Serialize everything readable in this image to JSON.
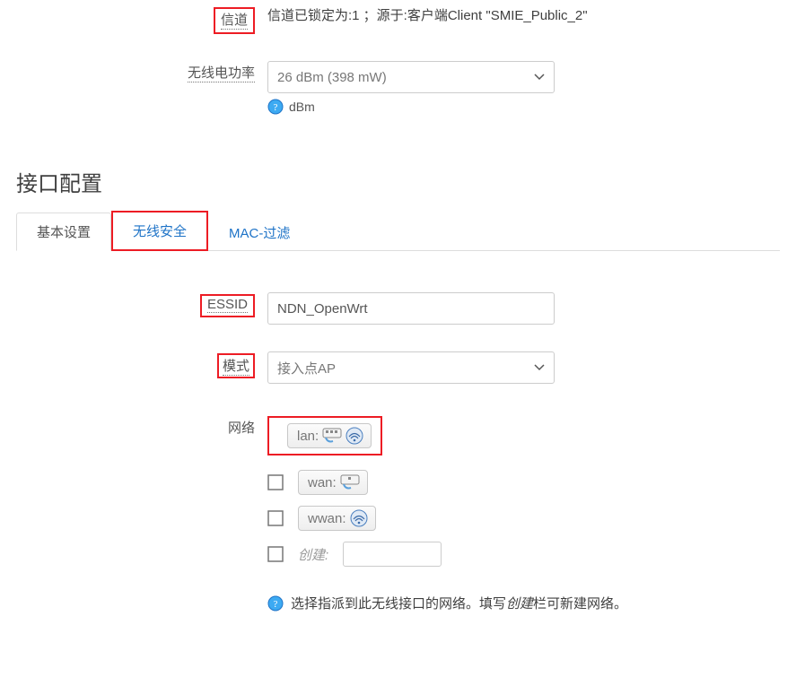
{
  "device": {
    "channel_label": "信道",
    "channel_status": "信道已锁定为:1 ；源于:客户端Client \"SMIE_Public_2\"",
    "txpower_label": "无线电功率",
    "txpower_value": "26 dBm (398 mW)",
    "txpower_unit": "dBm"
  },
  "section_title": "接口配置",
  "tabs": {
    "general": "基本设置",
    "security": "无线安全",
    "mac": "MAC-过滤"
  },
  "form": {
    "essid_label": "ESSID",
    "essid_value": "NDN_OpenWrt",
    "mode_label": "模式",
    "mode_value": "接入点AP",
    "network_label": "网络",
    "networks": [
      {
        "name": "lan:",
        "checked": true,
        "icons": [
          "eth",
          "wifi"
        ]
      },
      {
        "name": "wan:",
        "checked": false,
        "icons": [
          "eth"
        ]
      },
      {
        "name": "wwan:",
        "checked": false,
        "icons": [
          "wifi"
        ]
      }
    ],
    "create_label": "创建:",
    "network_hint_pre": "选择指派到此无线接口的网络。填写",
    "network_hint_italic": "创建",
    "network_hint_post": "栏可新建网络。"
  }
}
